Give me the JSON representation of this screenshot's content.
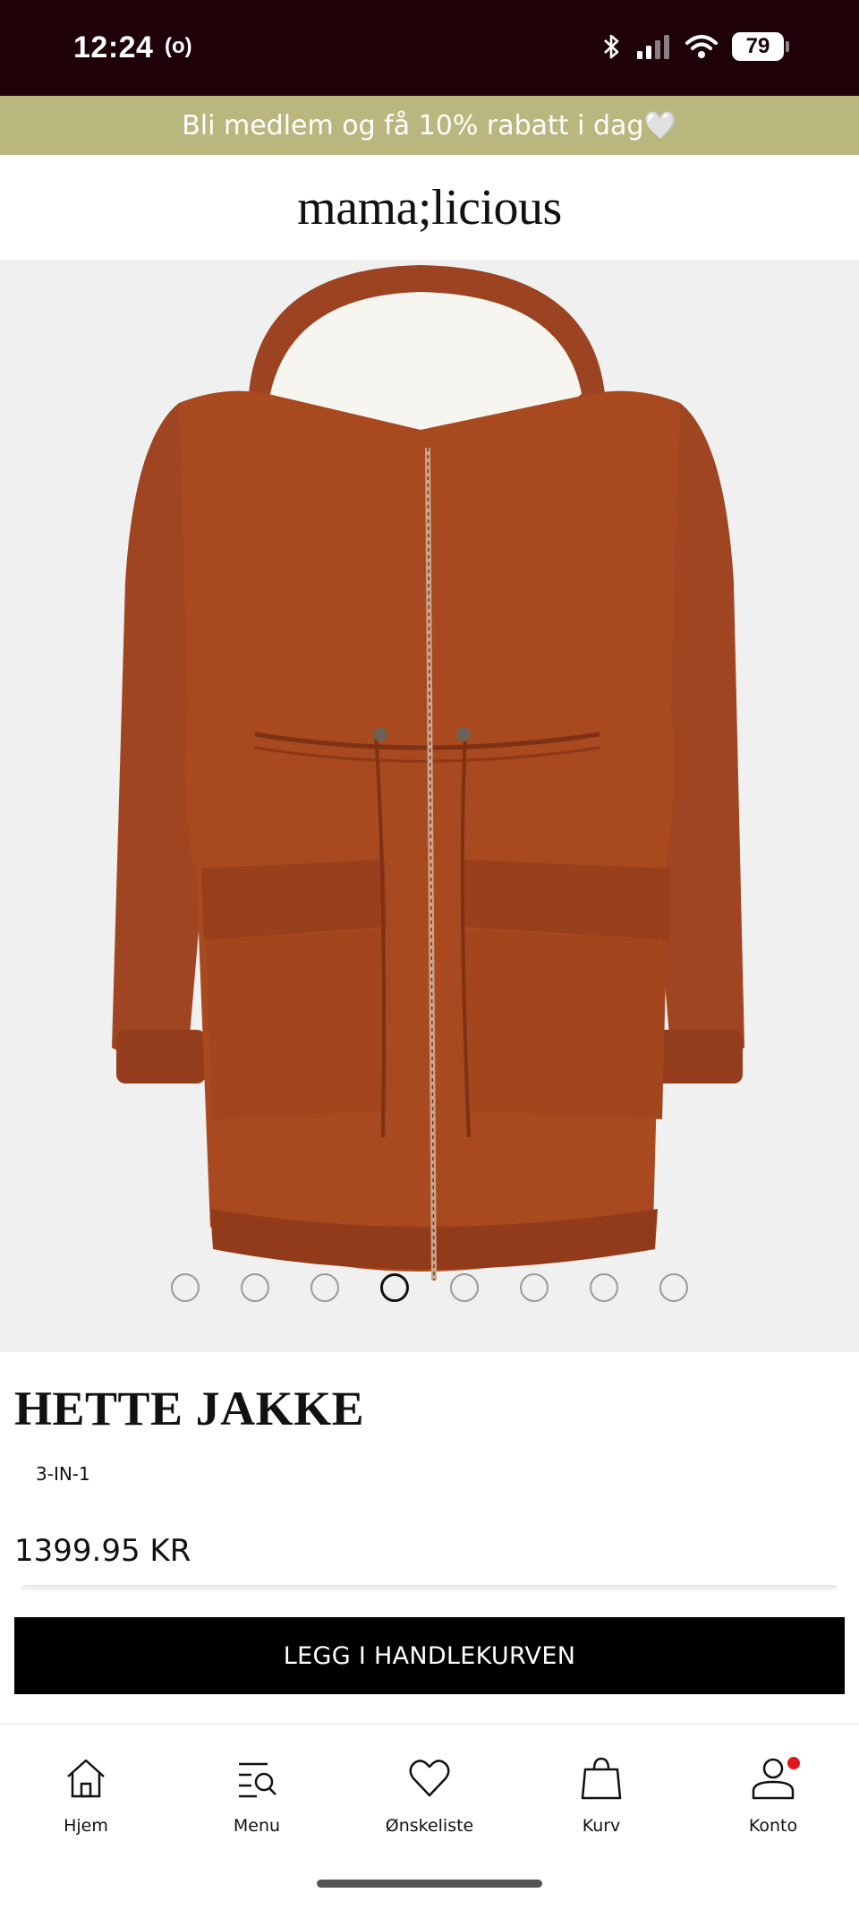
{
  "status_bar": {
    "time": "12:24",
    "extra": "(o)",
    "battery": "79"
  },
  "promo": {
    "text": "Bli medlem og få 10% rabatt i dag🤍"
  },
  "brand": {
    "logo": "mama;licious"
  },
  "product": {
    "image_icon": "hooded-parka-jacket",
    "colors": {
      "jacket": "#a04522",
      "lining": "#f7f5ef"
    },
    "carousel": {
      "count": 8,
      "active_index": 3
    },
    "title": "HETTE JAKKE",
    "subtitle": "3-IN-1",
    "price": "1399.95 KR"
  },
  "cta": {
    "add_to_cart": "LEGG I HANDLEKURVEN"
  },
  "nav": {
    "items": [
      {
        "label": "Hjem",
        "icon": "home-icon"
      },
      {
        "label": "Menu",
        "icon": "menu-search-icon"
      },
      {
        "label": "Ønskeliste",
        "icon": "heart-icon"
      },
      {
        "label": "Kurv",
        "icon": "shopping-bag-icon"
      },
      {
        "label": "Konto",
        "icon": "account-icon"
      }
    ]
  },
  "colors": {
    "status_bar": "#1e0207",
    "promo_banner": "#b9b67e",
    "notification": "#e01a1a"
  }
}
